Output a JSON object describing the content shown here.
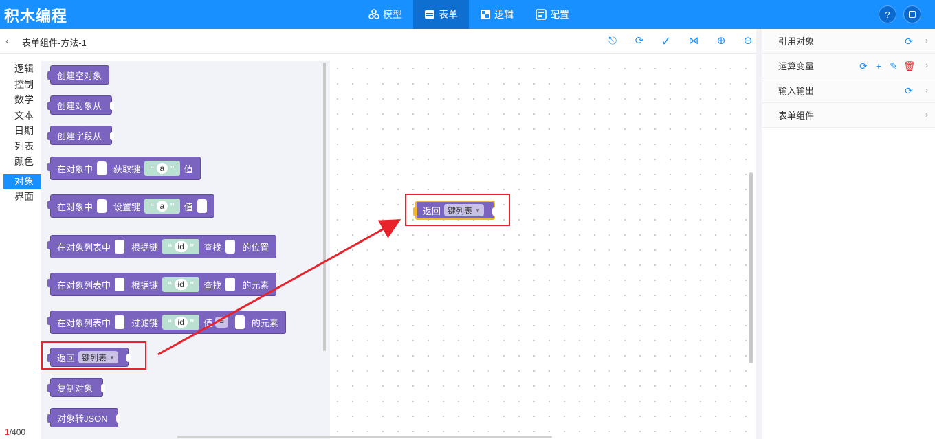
{
  "app": {
    "title": "积木编程"
  },
  "nav": {
    "tabs": [
      {
        "label": "模型",
        "icon": "cubes-icon"
      },
      {
        "label": "表单",
        "icon": "form-icon",
        "active": true
      },
      {
        "label": "逻辑",
        "icon": "logic-icon"
      },
      {
        "label": "配置",
        "icon": "config-icon"
      }
    ],
    "help_icon": "help-icon",
    "fullscreen_icon": "fullscreen-icon"
  },
  "toolbar": {
    "page_title": "表单组件-方法-1",
    "tools": [
      "clean-icon",
      "refresh-icon",
      "check-icon",
      "collapse-icon",
      "zoom-in-icon",
      "zoom-out-icon"
    ]
  },
  "categories": [
    "逻辑",
    "控制",
    "数学",
    "文本",
    "日期",
    "列表",
    "颜色",
    "对象",
    "界面"
  ],
  "active_category": "对象",
  "blocks": {
    "create_empty": "创建空对象",
    "create_from": "创建对象从",
    "create_field_from": "创建字段从",
    "get_key": {
      "p1": "在对象中",
      "p2": "获取键",
      "str": "a",
      "p3": "值"
    },
    "set_key": {
      "p1": "在对象中",
      "p2": "设置键",
      "str": "a",
      "p3": "值"
    },
    "find_pos": {
      "p1": "在对象列表中",
      "p2": "根据键",
      "str": "id",
      "p3": "查找",
      "p4": "的位置"
    },
    "find_elem": {
      "p1": "在对象列表中",
      "p2": "根据键",
      "str": "id",
      "p3": "查找",
      "p4": "的元素"
    },
    "filter": {
      "p1": "在对象列表中",
      "p2": "过滤键",
      "str": "id",
      "p3": "值",
      "op": "=",
      "p4": "的元素"
    },
    "return_keys": {
      "p1": "返回",
      "dd": "键列表"
    },
    "copy": "复制对象",
    "to_json": "对象转JSON"
  },
  "canvas_block": {
    "p1": "返回",
    "dd": "键列表"
  },
  "counter": {
    "current": "1",
    "total": "/400"
  },
  "right_panel": {
    "sections": [
      {
        "label": "引用对象"
      },
      {
        "label": "运算变量"
      },
      {
        "label": "输入输出"
      },
      {
        "label": "表单组件"
      }
    ]
  },
  "colors": {
    "primary": "#1890ff",
    "block": "#7a64bf",
    "annotation": "#e8232b"
  }
}
